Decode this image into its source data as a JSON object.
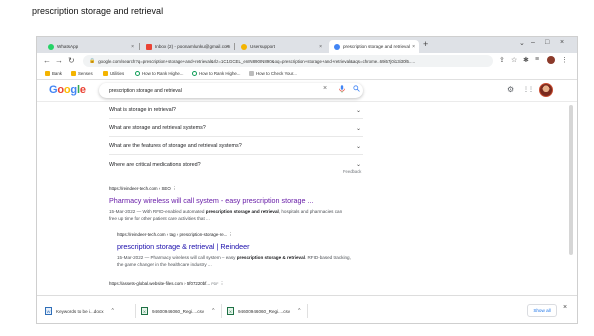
{
  "caption": "prescription storage and retrieval",
  "tabs": [
    {
      "label": "WhatsApp",
      "close": "×",
      "color": "#25d366"
    },
    {
      "label": "Inbox (2) - poonamlunku@gmail.com",
      "close": "×",
      "color": "#ea4335"
    },
    {
      "label": "Usersupport",
      "close": "×",
      "color": "#f4b400"
    },
    {
      "label": "prescription storage and retrieval",
      "close": "×",
      "color": "#4285f4"
    }
  ],
  "new_tab": "+",
  "window_controls": {
    "dropdown": "⌄",
    "minimize": "–",
    "maximize": "□",
    "close": "×"
  },
  "toolbar": {
    "back": "←",
    "forward": "→",
    "reload": "↻",
    "lock": "🔒",
    "url": "google.com/search?q=prescription+storage+and+retrieval&rlz=1C1GCEL_enIN890IN890&oq=prescription+storage+and+retrieval&aqs=chrome..69i57j0i13i30l5.....",
    "icons": [
      "⇪",
      "☆",
      "✱",
      "≡",
      "⋮"
    ]
  },
  "bookmarks": [
    {
      "label": "Bank",
      "color": "#f4b400"
    },
    {
      "label": "Senses",
      "color": "#f4b400"
    },
    {
      "label": "Utilities",
      "color": "#f4b400"
    },
    {
      "label": "How to Rank Highe...",
      "color": "#0f9d58"
    },
    {
      "label": "How to Rank Highe...",
      "color": "#0f9d58"
    },
    {
      "label": "How to Check Your...",
      "color": "#9e9e9e"
    }
  ],
  "google": {
    "logo": [
      {
        "ch": "G",
        "color": "#4285f4"
      },
      {
        "ch": "o",
        "color": "#ea4335"
      },
      {
        "ch": "o",
        "color": "#fbbc05"
      },
      {
        "ch": "g",
        "color": "#4285f4"
      },
      {
        "ch": "l",
        "color": "#34a853"
      },
      {
        "ch": "e",
        "color": "#ea4335"
      }
    ],
    "query": "prescription storage and retrieval",
    "clear": "×",
    "mic": "🎤",
    "search": "🔍",
    "settings_icon": "⚙",
    "apps_icon": "⋮⋮"
  },
  "people_also_ask": [
    {
      "question": "What is storage in retrieval?",
      "chev": "⌄"
    },
    {
      "question": "What are storage and retrieval systems?",
      "chev": "⌄"
    },
    {
      "question": "What are the features of storage and retrieval systems?",
      "chev": "⌄"
    },
    {
      "question": "Where are critical medications stored?",
      "chev": "⌄"
    }
  ],
  "feedback": "Feedback",
  "results": [
    {
      "cite": "https://reindeer-tech.com › SEO",
      "more": "⋮",
      "title": "Pharmacy wireless will call system - easy prescription storage ...",
      "snippet_date": "15-Mar-2022 — With RFID-enabled automated ",
      "snippet_bold": "prescription storage and retrieval",
      "snippet_rest": ", hospitals and pharmacies can free up time for other patient care activities that ..."
    },
    {
      "cite": "https://reindeer-tech.com › tag › prescription-storage-re...",
      "more": "⋮",
      "title": "prescription storage & retrieval | Reindeer",
      "snippet_date": "15-Mar-2022 — Pharmacy wireless will call system – easy ",
      "snippet_bold": "prescription storage & retrieval",
      "snippet_rest": ". RFID-based tracking, the game changer in the healthcare industry ..."
    },
    {
      "cite": "https://assets-global.website-files.com › 5f07220bf...",
      "badge": "PDF",
      "more": "⋮"
    }
  ],
  "downloads": [
    {
      "name": "Keywords to be i...docx",
      "icon": "W",
      "caret": "^"
    },
    {
      "name": "94600946060_Regi....csv",
      "icon": "X",
      "caret": "^"
    },
    {
      "name": "94600946060_Regi....csv",
      "icon": "X",
      "caret": "^"
    }
  ],
  "show_all": "Show all",
  "downloads_close": "×"
}
